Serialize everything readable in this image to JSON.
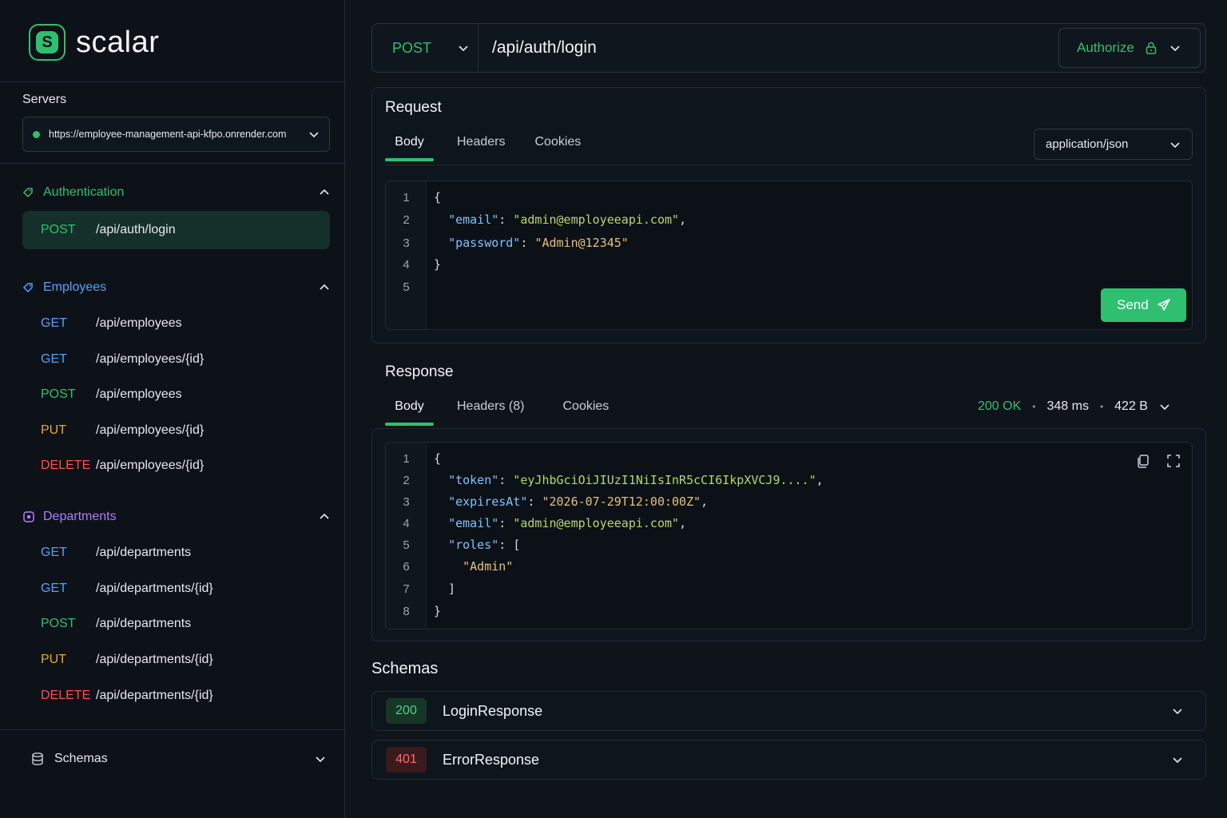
{
  "brand": {
    "name": "scalar",
    "logo_letter": "S"
  },
  "sidebar": {
    "servers_label": "Servers",
    "server_url": "https://employee-management-api-kfpo.onrender.com",
    "groups": [
      {
        "label": "Authentication",
        "color": "#2fbf71",
        "endpoints": [
          {
            "method": "POST",
            "path": "/api/auth/login",
            "active": true
          }
        ]
      },
      {
        "label": "Employees",
        "color": "#4da3ff",
        "endpoints": [
          {
            "method": "GET",
            "path": "/api/employees"
          },
          {
            "method": "GET",
            "path": "/api/employees/{id}"
          },
          {
            "method": "POST",
            "path": "/api/employees"
          },
          {
            "method": "PUT",
            "path": "/api/employees/{id}"
          },
          {
            "method": "DELETE",
            "path": "/api/employees/{id}"
          }
        ]
      },
      {
        "label": "Departments",
        "color": "#b07cff",
        "endpoints": [
          {
            "method": "GET",
            "path": "/api/departments"
          },
          {
            "method": "GET",
            "path": "/api/departments/{id}"
          },
          {
            "method": "POST",
            "path": "/api/departments"
          },
          {
            "method": "PUT",
            "path": "/api/departments/{id}"
          },
          {
            "method": "DELETE",
            "path": "/api/departments/{id}"
          }
        ]
      }
    ],
    "schemas_label": "Schemas"
  },
  "request_bar": {
    "method": "POST",
    "path": "/api/auth/login",
    "authorize_label": "Authorize"
  },
  "request": {
    "title": "Request",
    "tabs": [
      "Body",
      "Headers",
      "Cookies"
    ],
    "active_tab": "Body",
    "content_type": "application/json",
    "body_lines": [
      "{",
      "  \"email\": \"admin@employeeapi.com\",",
      "  \"password\": \"Admin@12345\"",
      "}",
      ""
    ],
    "send_label": "Send"
  },
  "response": {
    "title": "Response",
    "tabs": [
      "Body",
      "Headers (8)",
      "Cookies"
    ],
    "active_tab": "Body",
    "status": "200 OK",
    "time": "348 ms",
    "size": "422 B",
    "body_lines": [
      "{",
      "  \"token\": \"eyJhbGciOiJIUzI1NiIsInR5cCI6IkpXVCJ9....\",",
      "  \"expiresAt\": \"2026-07-29T12:00:00Z\",",
      "  \"email\": \"admin@employeeapi.com\",",
      "  \"roles\": [",
      "    \"Admin\"",
      "  ]",
      "}"
    ]
  },
  "schemas": {
    "title": "Schemas",
    "items": [
      {
        "code": "200",
        "name": "LoginResponse"
      },
      {
        "code": "401",
        "name": "ErrorResponse"
      }
    ]
  },
  "colors": {
    "accent": "#2fbf71",
    "get": "#4da3ff",
    "post": "#2fbf71",
    "put": "#f5a623",
    "delete": "#ff4d4f"
  }
}
